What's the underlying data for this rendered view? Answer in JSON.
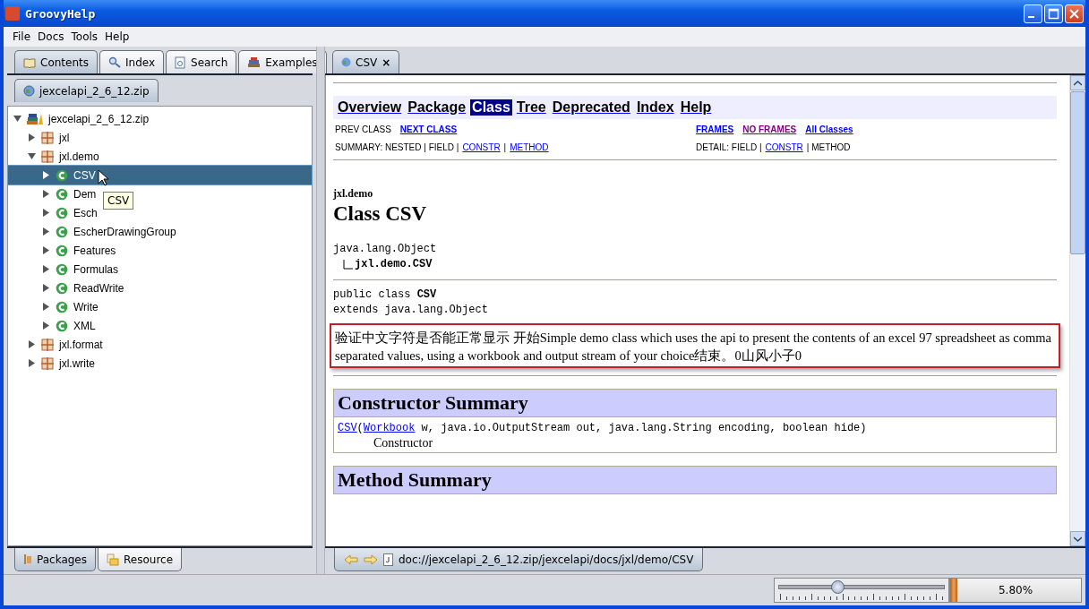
{
  "window": {
    "title": "GroovyHelp"
  },
  "menu": [
    "File",
    "Docs",
    "Tools",
    "Help"
  ],
  "left_tabs": [
    {
      "label": "Contents",
      "selected": true
    },
    {
      "label": "Index",
      "selected": false
    },
    {
      "label": "Search",
      "selected": false
    },
    {
      "label": "Examples",
      "selected": false
    }
  ],
  "archive_tab": {
    "label": "jexcelapi_2_6_12.zip"
  },
  "tree": [
    {
      "label": "jexcelapi_2_6_12.zip",
      "kind": "archive",
      "expanded": true,
      "selected": false,
      "children": [
        {
          "label": "jxl",
          "kind": "package",
          "expanded": false,
          "selected": false
        },
        {
          "label": "jxl.demo",
          "kind": "package",
          "expanded": true,
          "selected": false,
          "children": [
            {
              "label": "CSV",
              "kind": "class",
              "expanded": false,
              "selected": true
            },
            {
              "label": "Dem",
              "kind": "class",
              "expanded": false,
              "selected": false
            },
            {
              "label": "Esch",
              "kind": "class",
              "expanded": false,
              "selected": false
            },
            {
              "label": "EscherDrawingGroup",
              "kind": "class",
              "expanded": false,
              "selected": false
            },
            {
              "label": "Features",
              "kind": "class",
              "expanded": false,
              "selected": false
            },
            {
              "label": "Formulas",
              "kind": "class",
              "expanded": false,
              "selected": false
            },
            {
              "label": "ReadWrite",
              "kind": "class",
              "expanded": false,
              "selected": false
            },
            {
              "label": "Write",
              "kind": "class",
              "expanded": false,
              "selected": false
            },
            {
              "label": "XML",
              "kind": "class",
              "expanded": false,
              "selected": false
            }
          ]
        },
        {
          "label": "jxl.format",
          "kind": "package",
          "expanded": false,
          "selected": false
        },
        {
          "label": "jxl.write",
          "kind": "package",
          "expanded": false,
          "selected": false
        }
      ]
    }
  ],
  "tooltip": "CSV",
  "bottom_tabs": [
    {
      "label": "Packages",
      "selected": true
    },
    {
      "label": "Resource",
      "selected": false
    }
  ],
  "doc_tab": {
    "label": "CSV",
    "close": "×"
  },
  "doc": {
    "navbar": [
      {
        "label": "Overview",
        "selected": false
      },
      {
        "label": "Package",
        "selected": false
      },
      {
        "label": "Class",
        "selected": true
      },
      {
        "label": "Tree",
        "selected": false
      },
      {
        "label": "Deprecated",
        "selected": false
      },
      {
        "label": "Index",
        "selected": false
      },
      {
        "label": "Help",
        "selected": false
      }
    ],
    "nav_left": [
      {
        "text": "PREV CLASS",
        "kind": "text"
      },
      {
        "text": "NEXT CLASS",
        "kind": "link"
      }
    ],
    "nav_right": [
      {
        "text": "FRAMES",
        "kind": "link",
        "visited": false
      },
      {
        "text": "NO FRAMES",
        "kind": "link",
        "visited": true
      },
      {
        "text": "All Classes",
        "kind": "link",
        "visited": false
      }
    ],
    "summary": [
      {
        "text": "SUMMARY: NESTED | FIELD |",
        "kind": "text"
      },
      {
        "text": "CONSTR",
        "kind": "link"
      },
      {
        "text": "|",
        "kind": "text"
      },
      {
        "text": "METHOD",
        "kind": "link"
      }
    ],
    "detail": [
      {
        "text": "DETAIL: FIELD |",
        "kind": "text"
      },
      {
        "text": "CONSTR",
        "kind": "link"
      },
      {
        "text": "| METHOD",
        "kind": "text"
      }
    ],
    "package": "jxl.demo",
    "title": "Class CSV",
    "hierarchy": [
      "java.lang.Object",
      "jxl.demo.CSV"
    ],
    "declaration": [
      "public class **CSV**",
      "extends java.lang.Object"
    ],
    "description": "验证中文字符是否能正常显示 开始Simple demo class which uses the api to present the contents of an excel 97 spreadsheet as comma separated values, using a workbook and output stream of your choice结束。0山风小子0",
    "constructor_summary": {
      "heading": "Constructor Summary",
      "signature": [
        {
          "text": "CSV",
          "kind": "link"
        },
        {
          "text": "(",
          "kind": "text"
        },
        {
          "text": "Workbook",
          "kind": "link"
        },
        {
          "text": " w, java.io.OutputStream out, java.lang.String encoding, boolean hide)",
          "kind": "text"
        }
      ],
      "description": "Constructor"
    },
    "method_summary": {
      "heading": "Method Summary"
    }
  },
  "address": "doc://jexcelapi_2_6_12.zip/jexcelapi/docs/jxl/demo/CSV",
  "status_bar": {
    "zoom_slider": {
      "level": 0.36
    },
    "progress": {
      "level": 0.058,
      "reading": "5.80%"
    }
  }
}
